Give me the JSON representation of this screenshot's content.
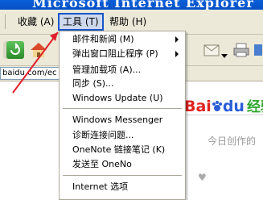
{
  "window": {
    "title": "Microsoft Internet Explorer"
  },
  "menubar": {
    "items": [
      {
        "label": "收藏 (A)"
      },
      {
        "label": "工具 (T)"
      },
      {
        "label": "帮助 (H)"
      }
    ]
  },
  "address": {
    "value": "baidu.com/ec"
  },
  "tools_menu": {
    "items": [
      {
        "label": "邮件和新闻 (M)",
        "submenu": true
      },
      {
        "label": "弹出窗口阻止程序 (P)",
        "submenu": true
      },
      {
        "label": "管理加载项 (A)...",
        "submenu": false
      },
      {
        "label": "同步 (S)...",
        "submenu": false
      },
      {
        "label": "Windows Update (U)",
        "submenu": false
      },
      {
        "label": "Windows Messenger",
        "submenu": false
      },
      {
        "label": "诊断连接问题...",
        "submenu": false
      },
      {
        "label": "OneNote 链接笔记 (K)",
        "submenu": false
      },
      {
        "label": "发送至 OneNo",
        "submenu": false
      },
      {
        "label": "Internet 选项",
        "submenu": false
      }
    ]
  },
  "page": {
    "logo_bai": "Bai",
    "logo_du": "du",
    "logo_jingyan": "经验",
    "text1": "今日创作的",
    "text2": "♥"
  },
  "colors": {
    "titlebar": "#0a5fd8",
    "menu_bg": "#ece9d8",
    "highlight_border": "#1a56c7",
    "arrow": "#e0202a"
  }
}
